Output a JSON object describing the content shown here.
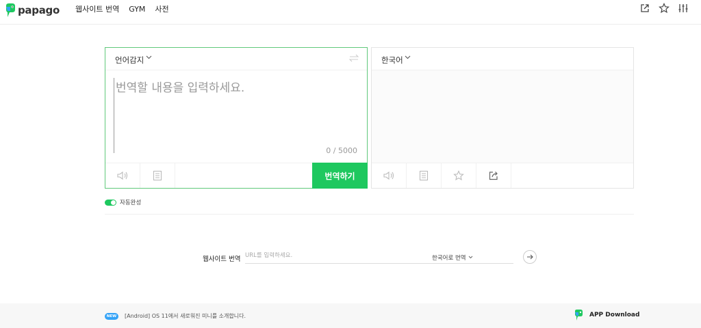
{
  "header": {
    "logo_text": "papago",
    "nav": [
      "웹사이트 번역",
      "GYM",
      "사전"
    ],
    "icons": [
      "open-window-icon",
      "star-icon",
      "settings-sliders-icon"
    ]
  },
  "source": {
    "language": "언어감지",
    "placeholder": "번역할 내용을 입력하세요.",
    "value": "",
    "counter": "0 / 5000",
    "translate_label": "번역하기"
  },
  "target": {
    "language": "한국어"
  },
  "autocomplete": {
    "label": "자동완성",
    "enabled": true
  },
  "website": {
    "label": "웹사이트 번역",
    "placeholder": "URL를 입력하세요.",
    "target_language": "한국어로 번역"
  },
  "footer": {
    "badge": "NEW",
    "notice": "[Android] OS 11에서 새로워진 미니를 소개합니다.",
    "app_download": "APP Download"
  },
  "colors": {
    "accent_green": "#1ec85f",
    "badge_blue": "#34a3f7"
  }
}
